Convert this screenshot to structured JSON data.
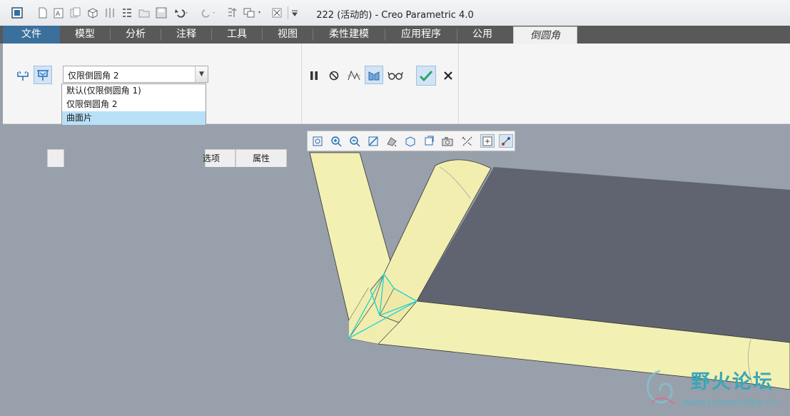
{
  "window": {
    "title": "222 (活动的) - Creo Parametric 4.0"
  },
  "tabs": [
    {
      "label": "文件"
    },
    {
      "label": "模型"
    },
    {
      "label": "分析"
    },
    {
      "label": "注释"
    },
    {
      "label": "工具"
    },
    {
      "label": "视图"
    },
    {
      "label": "柔性建模"
    },
    {
      "label": "应用程序"
    },
    {
      "label": "公用"
    },
    {
      "label": "倒圆角"
    }
  ],
  "ribbon": {
    "set_select": {
      "value": "仅限倒圆角 2"
    },
    "dropdown_options": [
      "默认(仅限倒圆角 1)",
      "仅限倒圆角 2",
      "曲面片"
    ],
    "dropdown_selected_index": 2,
    "sheets": [
      {
        "label": "选项"
      },
      {
        "label": "属性"
      }
    ]
  },
  "watermark": {
    "text": "野火论坛",
    "url": "www.proewildfire.cn"
  },
  "colors": {
    "accent": "#3b6f9c",
    "model_tube": "#f3f0b4",
    "model_plate": "#5f6470",
    "highlight_edge": "#22d3d0"
  }
}
